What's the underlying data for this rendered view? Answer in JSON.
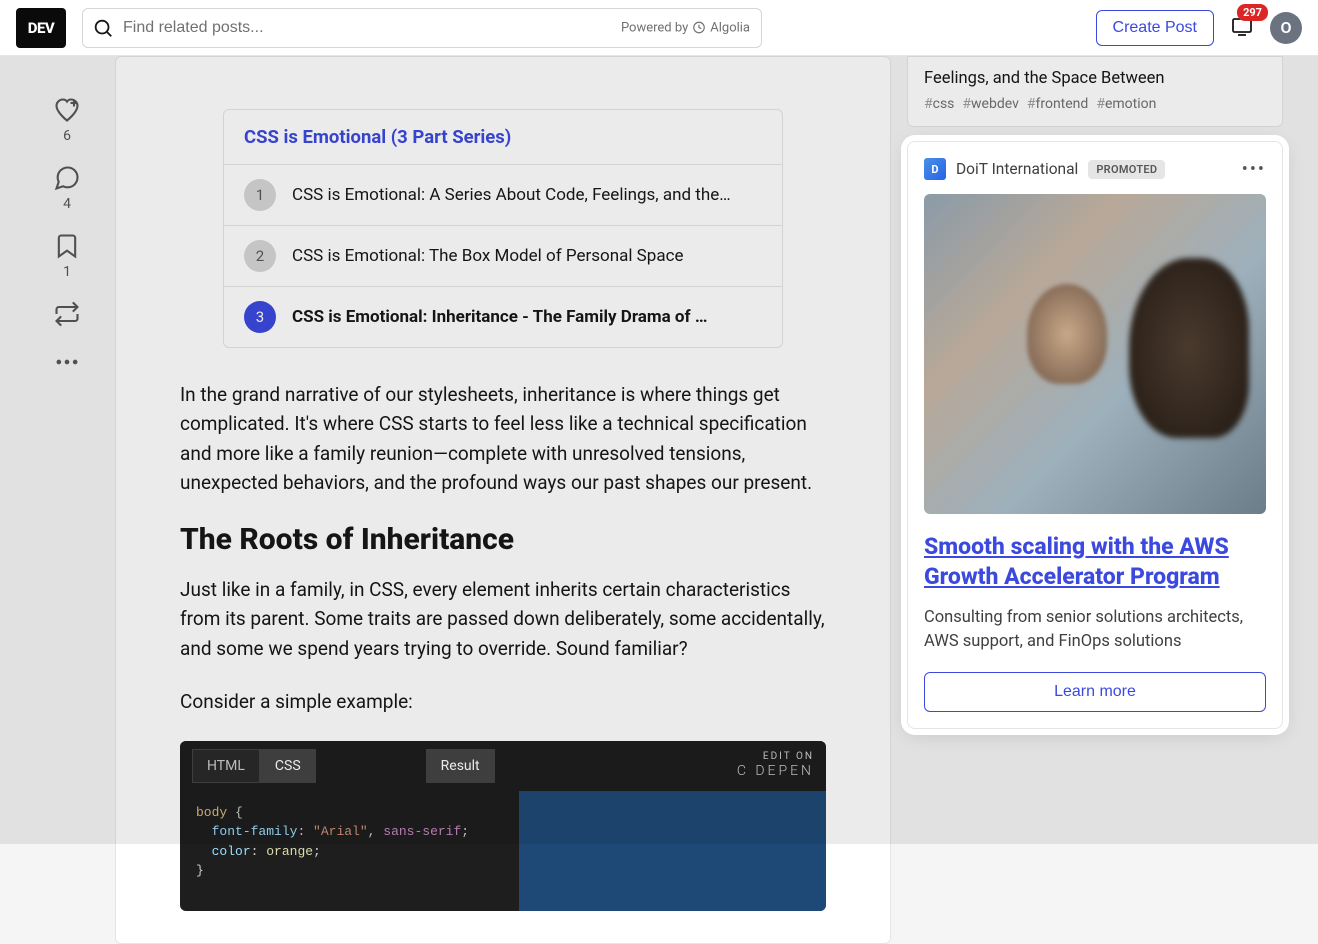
{
  "header": {
    "logo": "DEV",
    "search_placeholder": "Find related posts...",
    "powered_by": "Powered by",
    "algolia": "Algolia",
    "create_post": "Create Post",
    "notif_count": "297",
    "avatar_initial": "O"
  },
  "reactions": {
    "like_count": "6",
    "comment_count": "4",
    "save_count": "1"
  },
  "series": {
    "title": "CSS is Emotional (3 Part Series)",
    "items": [
      {
        "num": "1",
        "label": "CSS is Emotional: A Series About Code, Feelings, and the…"
      },
      {
        "num": "2",
        "label": "CSS is Emotional: The Box Model of Personal Space"
      },
      {
        "num": "3",
        "label": "CSS is Emotional: Inheritance - The Family Drama of …"
      }
    ]
  },
  "article": {
    "p1": "In the grand narrative of our stylesheets, inheritance is where things get complicated. It's where CSS starts to feel less like a technical specification and more like a family reunion—complete with unresolved tensions, unexpected behaviors, and the profound ways our past shapes our present.",
    "h2_1": "The Roots of Inheritance",
    "p2": "Just like in a family, in CSS, every element inherits certain characteristics from its parent. Some traits are passed down deliberately, some accidentally, and some we spend years trying to override. Sound familiar?",
    "p3": "Consider a simple example:"
  },
  "codepen": {
    "tab_html": "HTML",
    "tab_css": "CSS",
    "tab_result": "Result",
    "edit_on": "EDIT ON",
    "brand": "C   DEPEN",
    "code": {
      "l1_sel": "body",
      "l1_brace": "{",
      "l2_prop": "font-family",
      "l2_colon": ": ",
      "l2_str": "\"Arial\"",
      "l2_comma": ", ",
      "l2_kw": "sans-serif",
      "l2_semi": ";",
      "l3_prop": "color",
      "l3_colon": ": ",
      "l3_val": "orange",
      "l3_semi": ";",
      "l4": "}"
    }
  },
  "rail_top": {
    "title": "Feelings, and the Space Between",
    "tags": [
      "css",
      "webdev",
      "frontend",
      "emotion"
    ]
  },
  "promo": {
    "brand": "DoiT International",
    "badge": "PROMOTED",
    "title": "Smooth scaling with the AWS Growth Accelerator Program",
    "desc": "Consulting from senior solutions architects, AWS support, and FinOps solutions",
    "cta": "Learn more"
  }
}
